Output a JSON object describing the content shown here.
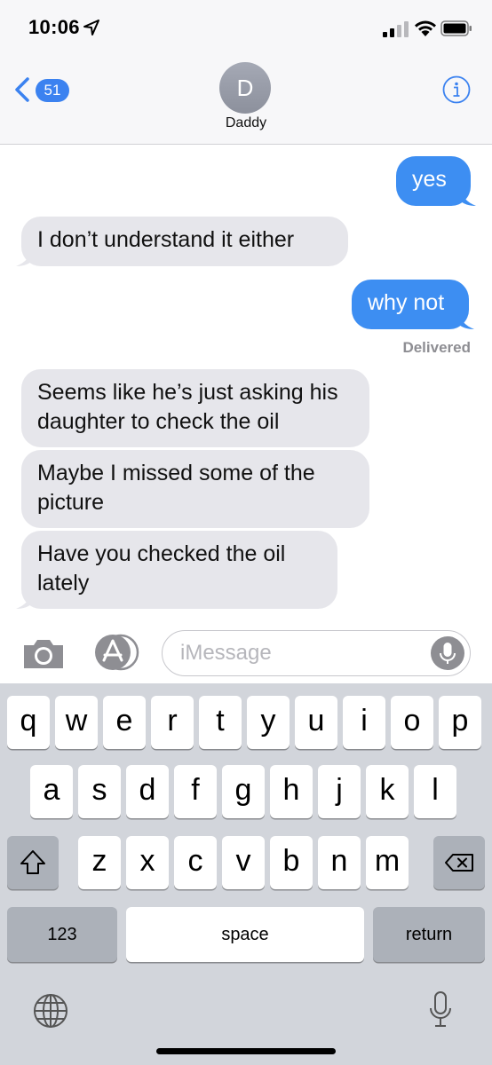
{
  "status_bar": {
    "time": "10:06",
    "icons": [
      "location-arrow-icon",
      "signal-icon",
      "wifi-icon",
      "battery-icon"
    ]
  },
  "header": {
    "back_count": "51",
    "avatar_initial": "D",
    "contact_name": "Daddy",
    "icons": [
      "back-chevron-icon",
      "info-icon"
    ]
  },
  "messages": [
    {
      "direction": "outgoing",
      "text": "yes"
    },
    {
      "direction": "incoming",
      "text": "I don’t understand it either"
    },
    {
      "direction": "outgoing",
      "text": "why not"
    },
    {
      "direction": "incoming",
      "text": "Seems like he’s just asking his daughter to check the oil"
    },
    {
      "direction": "incoming",
      "text": "Maybe I missed some of the picture"
    },
    {
      "direction": "incoming",
      "text": "Have you checked the oil lately"
    }
  ],
  "delivery_status": "Delivered",
  "composer": {
    "placeholder": "iMessage",
    "icons": [
      "camera-icon",
      "app-store-icon",
      "microphone-icon"
    ]
  },
  "keyboard": {
    "row1": [
      "q",
      "w",
      "e",
      "r",
      "t",
      "y",
      "u",
      "i",
      "o",
      "p"
    ],
    "row2": [
      "a",
      "s",
      "d",
      "f",
      "g",
      "h",
      "j",
      "k",
      "l"
    ],
    "row3": [
      "z",
      "x",
      "c",
      "v",
      "b",
      "n",
      "m"
    ],
    "numbers_label": "123",
    "space_label": "space",
    "return_label": "return",
    "icons": [
      "shift-icon",
      "delete-icon",
      "globe-icon",
      "dictation-mic-icon"
    ]
  },
  "colors": {
    "outgoing_bubble": "#3d8ef2",
    "incoming_bubble": "#e6e6eb",
    "accent": "#3b82f0"
  }
}
